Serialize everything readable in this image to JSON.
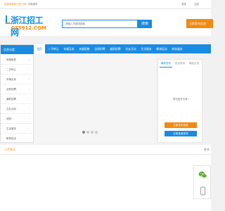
{
  "topbar": {
    "welcome": "欢迎来到浙江招工网!",
    "location": "切换城市",
    "login": "登录",
    "register": "注册"
  },
  "header": {
    "logo_cn": "浙江招工网",
    "logo_en": "075912.COM",
    "search_placeholder": "请输入关键词搜索",
    "search_button": "搜索",
    "post_button": "立即发布信息"
  },
  "nav": {
    "items": [
      {
        "label": "首页",
        "active": true
      },
      {
        "label": "二手转让",
        "active": false
      },
      {
        "label": "车辆买卖",
        "active": false
      },
      {
        "label": "房屋租售",
        "active": false
      },
      {
        "label": "全职招聘",
        "active": false
      },
      {
        "label": "兼职招聘",
        "active": false
      },
      {
        "label": "交友活动",
        "active": false
      },
      {
        "label": "生活服务",
        "active": false
      },
      {
        "label": "教育培训",
        "active": false
      },
      {
        "label": "商务服务",
        "active": false
      }
    ]
  },
  "categories": {
    "title": "信息分类",
    "items": [
      "房屋租售",
      "二手转让",
      "车辆买卖",
      "全职招聘",
      "兼职招聘",
      "交友活动",
      "宠物",
      "生活服务",
      "教育培训",
      "商务服务"
    ]
  },
  "panel": {
    "tabs": [
      {
        "label": "最新发布",
        "active": true
      },
      {
        "label": "热点资讯",
        "active": false
      },
      {
        "label": "网站公告",
        "active": false
      }
    ],
    "empty_text": "暂无相关记录!",
    "post_button": "立即发布信息",
    "register_button": "注册免费发布"
  },
  "section": {
    "title": "二手转让",
    "more": "更多"
  },
  "colors": {
    "brand_blue": "#1a8be0",
    "accent_orange": "#f08a10"
  },
  "icons": {
    "float_top": "wechat-icon",
    "float_bottom": "mobile-icon"
  }
}
